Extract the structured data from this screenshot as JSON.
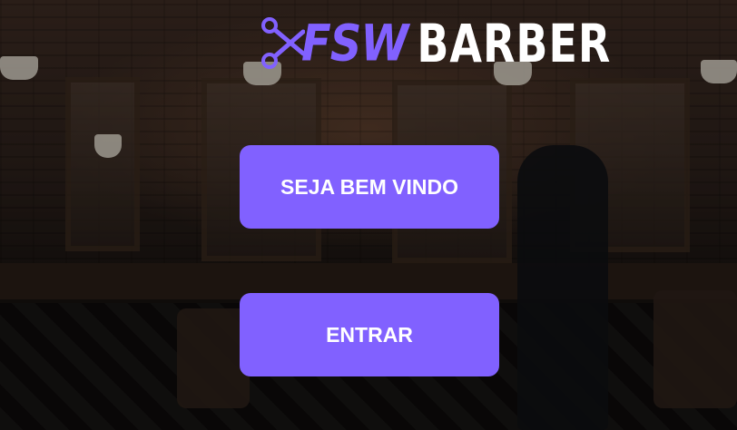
{
  "logo": {
    "icon": "scissors-icon",
    "part1": "FSW",
    "part2": "BARBER"
  },
  "buttons": {
    "welcome_label": "SEJA BEM VINDO",
    "enter_label": "ENTRAR"
  },
  "colors": {
    "accent": "#8161ff",
    "button_text": "#ffffff",
    "logo_white": "#ffffff"
  }
}
